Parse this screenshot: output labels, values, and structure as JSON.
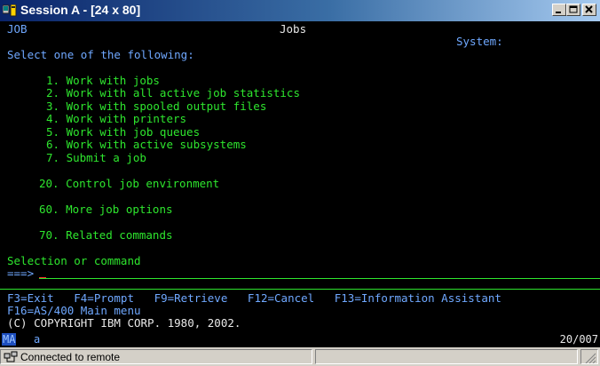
{
  "window": {
    "title": "Session A - [24 x 80]"
  },
  "screen": {
    "job_id": "JOB",
    "title": "Jobs",
    "system_label": "System:",
    "instruction": "Select one of the following:",
    "options": [
      {
        "label": "1. Work with jobs"
      },
      {
        "label": "2. Work with all active job statistics"
      },
      {
        "label": "3. Work with spooled output files"
      },
      {
        "label": "4. Work with printers"
      },
      {
        "label": "5. Work with job queues"
      },
      {
        "label": "6. Work with active subsystems"
      },
      {
        "label": "7. Submit a job"
      },
      {
        "label": "20. Control job environment"
      },
      {
        "label": "60. More job options"
      },
      {
        "label": "70. Related commands"
      }
    ],
    "selection_label": "Selection or command",
    "prompt": "===>",
    "function_keys_line1": "F3=Exit   F4=Prompt   F9=Retrieve   F12=Cancel   F13=Information Assistant",
    "function_keys_line2": "F16=AS/400 Main menu",
    "copyright": "(C) COPYRIGHT IBM CORP. 1980, 2002."
  },
  "oia": {
    "mode": "MA",
    "indicator": "a",
    "cursor_position": "20/007"
  },
  "statusbar": {
    "connection": "Connected to remote"
  },
  "colors": {
    "terminal_green": "#2ee62e",
    "terminal_blue": "#6fa8ff",
    "terminal_bg": "#000000",
    "cursor": "#ff2a2a"
  }
}
